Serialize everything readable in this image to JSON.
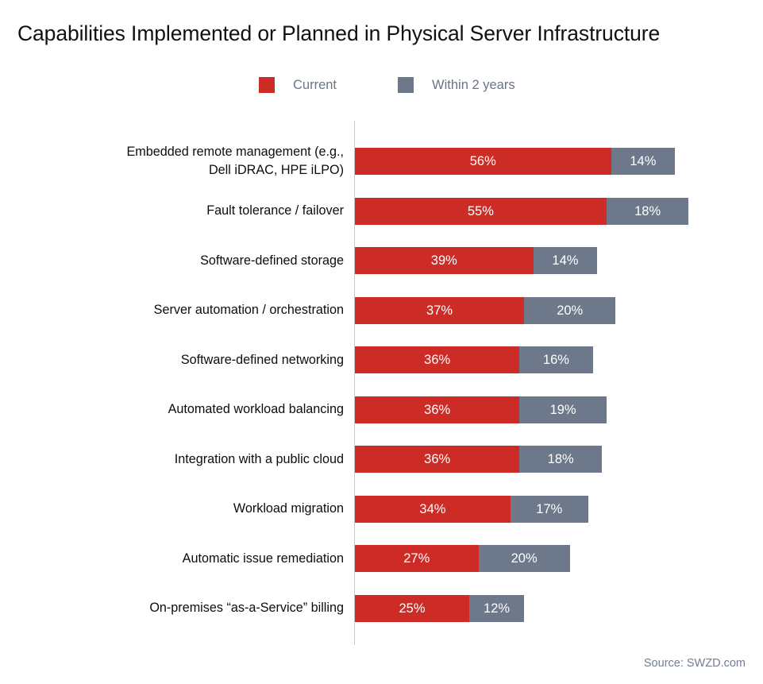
{
  "title": "Capabilities Implemented or Planned in Physical Server Infrastructure",
  "legend": {
    "items": [
      {
        "label": "Current",
        "color": "#cd2c26",
        "swatch": "legend-swatch-current"
      },
      {
        "label": "Within 2 years",
        "color": "#6d788b",
        "swatch": "legend-swatch-within-2-years"
      }
    ]
  },
  "source": "Source: SWZD.com",
  "chart_data": {
    "type": "bar",
    "orientation": "horizontal",
    "stacked": true,
    "title": "Capabilities Implemented or Planned in Physical Server Infrastructure",
    "xlabel": "",
    "ylabel": "",
    "xlim": [
      0,
      70
    ],
    "grid": false,
    "legend_position": "top-center",
    "value_suffix": "%",
    "colors": {
      "Current": "#cd2c26",
      "Within 2 years": "#6d788b"
    },
    "categories": [
      "Embedded remote management (e.g., Dell iDRAC, HPE iLPO)",
      "Fault tolerance / failover",
      "Software-defined storage",
      "Server automation / orchestration",
      "Software-defined networking",
      "Automated workload balancing",
      "Integration with a public cloud",
      "Workload migration",
      "Automatic issue remediation",
      "On-premises “as-a-Service” billing"
    ],
    "category_lines": [
      [
        "Embedded remote management (e.g.,",
        "Dell iDRAC, HPE iLPO)"
      ],
      [
        "Fault tolerance / failover"
      ],
      [
        "Software-defined storage"
      ],
      [
        "Server automation / orchestration"
      ],
      [
        "Software-defined networking"
      ],
      [
        "Automated workload balancing"
      ],
      [
        "Integration with a public cloud"
      ],
      [
        "Workload migration"
      ],
      [
        "Automatic issue remediation"
      ],
      [
        "On-premises “as-a-Service” billing"
      ]
    ],
    "series": [
      {
        "name": "Current",
        "values": [
          56,
          55,
          39,
          37,
          36,
          36,
          36,
          34,
          27,
          25
        ]
      },
      {
        "name": "Within 2 years",
        "values": [
          14,
          18,
          14,
          20,
          16,
          19,
          18,
          17,
          20,
          12
        ]
      }
    ],
    "labels": {
      "Current": [
        "56%",
        "55%",
        "39%",
        "37%",
        "36%",
        "36%",
        "36%",
        "34%",
        "27%",
        "25%"
      ],
      "Within 2 years": [
        "14%",
        "18%",
        "14%",
        "20%",
        "16%",
        "19%",
        "18%",
        "17%",
        "20%",
        "12%"
      ]
    }
  }
}
